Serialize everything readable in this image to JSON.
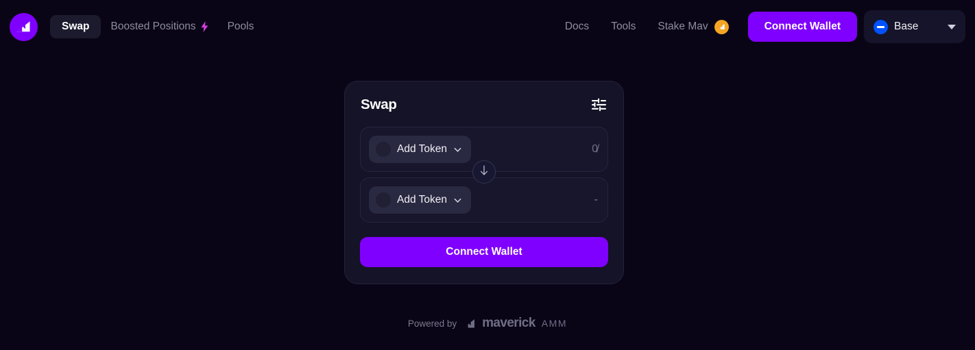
{
  "colors": {
    "background": "#0a0516",
    "card": "#141327",
    "accent_purple": "#8000ff",
    "badge_orange": "#f5a524",
    "base_blue": "#0052ff",
    "bolt_pink": "#d43ce0",
    "muted_text": "#8d8ca0"
  },
  "header": {
    "logo_icon": "maverick-logo-icon",
    "nav_left": [
      {
        "label": "Swap",
        "active": true,
        "icon": null
      },
      {
        "label": "Boosted Positions",
        "active": false,
        "icon": "lightning-bolt-icon"
      },
      {
        "label": "Pools",
        "active": false,
        "icon": null
      }
    ],
    "nav_right": [
      {
        "label": "Docs",
        "icon": null
      },
      {
        "label": "Tools",
        "icon": null
      },
      {
        "label": "Stake Mav",
        "icon": "mav-token-badge-icon"
      }
    ],
    "connect_wallet_label": "Connect Wallet",
    "chain": {
      "name": "Base",
      "icon": "base-chain-icon",
      "caret": "chevron-down-icon"
    }
  },
  "swap_card": {
    "title": "Swap",
    "settings_icon": "sliders-settings-icon",
    "swap_direction_icon": "arrow-down-icon",
    "rows": [
      {
        "token_label": "Add Token",
        "token_icon": "token-placeholder-icon",
        "chevron": "chevron-down-icon",
        "amount": "0̸"
      },
      {
        "token_label": "Add Token",
        "token_icon": "token-placeholder-icon",
        "chevron": "chevron-down-icon",
        "amount": "-"
      }
    ],
    "connect_wallet_label": "Connect Wallet"
  },
  "footer": {
    "powered_by": "Powered by",
    "brand_mark": "maverick-mark-icon",
    "brand_word": "maverick",
    "brand_suffix": "AMM"
  }
}
